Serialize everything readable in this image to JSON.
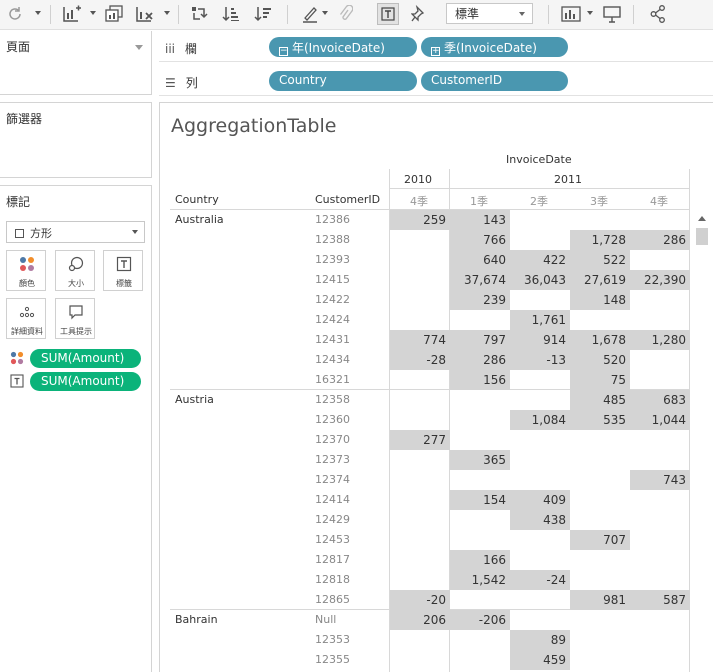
{
  "toolbar": {
    "format_dropdown": "標準",
    "colors": {
      "background": "#f5f5f5",
      "icon": "#555555"
    }
  },
  "left_panels": {
    "pages_title": "頁面",
    "filters_title": "篩選器",
    "marks_title": "標記",
    "mark_type": "方形",
    "mark_buttons": [
      "顏色",
      "大小",
      "標籤",
      "詳細資料",
      "工具提示"
    ],
    "mark_pills": [
      "SUM(Amount)",
      "SUM(Amount)"
    ],
    "colors": {
      "pill_green": "#0bb37a"
    }
  },
  "shelves": {
    "columns_label": "欄",
    "rows_label": "列",
    "columns_pills": [
      "年(InvoiceDate)",
      "季(InvoiceDate)"
    ],
    "rows_pills": [
      "Country",
      "CustomerID"
    ],
    "colors": {
      "pill_blue": "#4a97b0"
    }
  },
  "view": {
    "title": "AggregationTable",
    "column_header_top": "InvoiceDate",
    "row_header_labels": [
      "Country",
      "CustomerID"
    ],
    "years": [
      "2010",
      "2011"
    ],
    "quarters": [
      "4季",
      "1季",
      "2季",
      "3季",
      "4季"
    ],
    "colors": {
      "cell_fill": "#d4d4d4"
    }
  },
  "chart_data": {
    "type": "table",
    "title": "AggregationTable",
    "row_dimensions": [
      "Country",
      "CustomerID"
    ],
    "column_dimensions": [
      "Year",
      "Quarter"
    ],
    "columns": [
      "2010 4季",
      "2011 1季",
      "2011 2季",
      "2011 3季",
      "2011 4季"
    ],
    "rows": [
      {
        "country": "Australia",
        "customer": "12386",
        "values": [
          "259",
          "143",
          "",
          "",
          ""
        ]
      },
      {
        "country": "",
        "customer": "12388",
        "values": [
          "",
          "766",
          "",
          "1,728",
          "286"
        ]
      },
      {
        "country": "",
        "customer": "12393",
        "values": [
          "",
          "640",
          "422",
          "522",
          ""
        ]
      },
      {
        "country": "",
        "customer": "12415",
        "values": [
          "",
          "37,674",
          "36,043",
          "27,619",
          "22,390"
        ]
      },
      {
        "country": "",
        "customer": "12422",
        "values": [
          "",
          "239",
          "",
          "148",
          ""
        ]
      },
      {
        "country": "",
        "customer": "12424",
        "values": [
          "",
          "",
          "1,761",
          "",
          ""
        ]
      },
      {
        "country": "",
        "customer": "12431",
        "values": [
          "774",
          "797",
          "914",
          "1,678",
          "1,280"
        ]
      },
      {
        "country": "",
        "customer": "12434",
        "values": [
          "-28",
          "286",
          "-13",
          "520",
          ""
        ]
      },
      {
        "country": "",
        "customer": "16321",
        "values": [
          "",
          "156",
          "",
          "75",
          ""
        ]
      },
      {
        "country": "Austria",
        "customer": "12358",
        "values": [
          "",
          "",
          "",
          "485",
          "683"
        ]
      },
      {
        "country": "",
        "customer": "12360",
        "values": [
          "",
          "",
          "1,084",
          "535",
          "1,044"
        ]
      },
      {
        "country": "",
        "customer": "12370",
        "values": [
          "277",
          "",
          "",
          "",
          ""
        ]
      },
      {
        "country": "",
        "customer": "12373",
        "values": [
          "",
          "365",
          "",
          "",
          ""
        ]
      },
      {
        "country": "",
        "customer": "12374",
        "values": [
          "",
          "",
          "",
          "",
          "743"
        ]
      },
      {
        "country": "",
        "customer": "12414",
        "values": [
          "",
          "154",
          "409",
          "",
          ""
        ]
      },
      {
        "country": "",
        "customer": "12429",
        "values": [
          "",
          "",
          "438",
          "",
          ""
        ]
      },
      {
        "country": "",
        "customer": "12453",
        "values": [
          "",
          "",
          "",
          "707",
          ""
        ]
      },
      {
        "country": "",
        "customer": "12817",
        "values": [
          "",
          "166",
          "",
          "",
          ""
        ]
      },
      {
        "country": "",
        "customer": "12818",
        "values": [
          "",
          "1,542",
          "-24",
          "",
          ""
        ]
      },
      {
        "country": "",
        "customer": "12865",
        "values": [
          "-20",
          "",
          "",
          "981",
          "587"
        ]
      },
      {
        "country": "Bahrain",
        "customer": "Null",
        "values": [
          "206",
          "-206",
          "",
          "",
          ""
        ]
      },
      {
        "country": "",
        "customer": "12353",
        "values": [
          "",
          "",
          "89",
          "",
          ""
        ]
      },
      {
        "country": "",
        "customer": "12355",
        "values": [
          "",
          "",
          "459",
          "",
          ""
        ]
      }
    ]
  }
}
